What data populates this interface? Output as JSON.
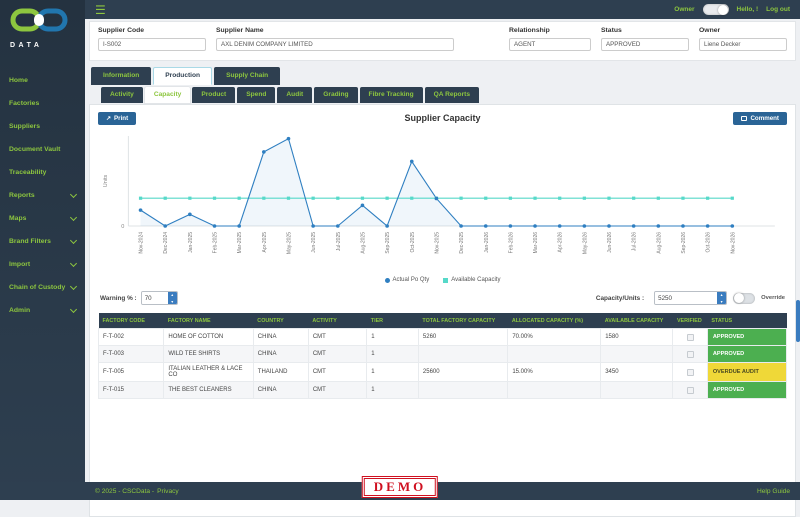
{
  "colors": {
    "dark": "#2e3f50",
    "accent_green": "#8dc63f",
    "button_blue": "#2a6496",
    "badge_green": "#4caf50",
    "badge_yellow": "#efd838",
    "actual_line": "#2f7fc1",
    "available_line": "#56d9c9",
    "demo_red": "#cf1020"
  },
  "logo": {
    "brand": "CSC",
    "sub": "DATA"
  },
  "topbar": {
    "owner_toggle_label": "Owner",
    "greeting": "Hello, !",
    "logout": "Log out"
  },
  "sidebar": {
    "items": [
      {
        "label": "Home",
        "expandable": false
      },
      {
        "label": "Factories",
        "expandable": false
      },
      {
        "label": "Suppliers",
        "expandable": false
      },
      {
        "label": "Document Vault",
        "expandable": false
      },
      {
        "label": "Traceability",
        "expandable": false
      },
      {
        "label": "Reports",
        "expandable": true
      },
      {
        "label": "Maps",
        "expandable": true
      },
      {
        "label": "Brand Filters",
        "expandable": true
      },
      {
        "label": "Import",
        "expandable": true
      },
      {
        "label": "Chain of Custody",
        "expandable": true
      },
      {
        "label": "Admin",
        "expandable": true
      }
    ]
  },
  "supplier_form": {
    "fields": [
      {
        "label": "Supplier Code",
        "value": "I-S002"
      },
      {
        "label": "Supplier Name",
        "value": "AXL DENIM COMPANY LIMITED"
      },
      {
        "label": "Relationship",
        "value": "AGENT"
      },
      {
        "label": "Status",
        "value": "APPROVED"
      },
      {
        "label": "Owner",
        "value": "Liene Decker"
      }
    ]
  },
  "tabs": {
    "main": [
      {
        "label": "Information",
        "active": false
      },
      {
        "label": "Production",
        "active": true
      },
      {
        "label": "Supply Chain",
        "active": false
      }
    ],
    "sub": [
      {
        "label": "Activity",
        "active": false
      },
      {
        "label": "Capacity",
        "active": true
      },
      {
        "label": "Product",
        "active": false
      },
      {
        "label": "Spend",
        "active": false
      },
      {
        "label": "Audit",
        "active": false
      },
      {
        "label": "Grading",
        "active": false
      },
      {
        "label": "Fibre Tracking",
        "active": false
      },
      {
        "label": "QA Reports",
        "active": false
      }
    ]
  },
  "chart_card": {
    "print_label": "Print",
    "comment_label": "Comment",
    "title": "Supplier Capacity"
  },
  "chart_data": {
    "type": "line",
    "title": "Supplier Capacity",
    "ylabel": "Units",
    "ylim": [
      0,
      17000
    ],
    "grid": false,
    "legend_position": "bottom",
    "x": [
      "Nov-2024",
      "Dec-2024",
      "Jan-2025",
      "Feb-2025",
      "Mar-2025",
      "Apr-2025",
      "May-2025",
      "Jun-2025",
      "Jul-2025",
      "Aug-2025",
      "Sep-2025",
      "Oct-2025",
      "Nov-2025",
      "Dec-2025",
      "Jan-2026",
      "Feb-2026",
      "Mar-2026",
      "Apr-2026",
      "May-2026",
      "Jun-2026",
      "Jul-2026",
      "Aug-2026",
      "Sep-2026",
      "Oct-2026",
      "Nov-2026"
    ],
    "series": [
      {
        "name": "Actual Po Qty",
        "color": "#2f7fc1",
        "marker": "circle",
        "values": [
          3000,
          0,
          2200,
          0,
          0,
          14000,
          16500,
          0,
          0,
          3900,
          0,
          12200,
          5200,
          0,
          0,
          0,
          0,
          0,
          0,
          0,
          0,
          0,
          0,
          0,
          0
        ]
      },
      {
        "name": "Available Capacity",
        "color": "#56d9c9",
        "marker": "square",
        "values": [
          5250,
          5250,
          5250,
          5250,
          5250,
          5250,
          5250,
          5250,
          5250,
          5250,
          5250,
          5250,
          5250,
          5250,
          5250,
          5250,
          5250,
          5250,
          5250,
          5250,
          5250,
          5250,
          5250,
          5250,
          5250
        ]
      }
    ]
  },
  "controls": {
    "warning_label": "Warning % :",
    "warning_value": "70",
    "capacity_label": "Capacity/Units :",
    "capacity_value": "5250",
    "override_label": "Override"
  },
  "table": {
    "headers": [
      "FACTORY CODE",
      "FACTORY NAME",
      "COUNTRY",
      "ACTIVITY",
      "TIER",
      "TOTAL FACTORY CAPACITY",
      "ALLOCATED CAPACITY (%)",
      "AVAILABLE CAPACITY",
      "VERIFIED",
      "STATUS"
    ],
    "rows": [
      {
        "code": "F-T-002",
        "name": "HOME OF COTTON",
        "country": "CHINA",
        "activity": "CMT",
        "tier": "1",
        "total": "5260",
        "allocated": "70.00%",
        "available": "1580",
        "verified": false,
        "status": "APPROVED",
        "status_type": "green"
      },
      {
        "code": "F-T-003",
        "name": "WILD TEE SHIRTS",
        "country": "CHINA",
        "activity": "CMT",
        "tier": "1",
        "total": "",
        "allocated": "",
        "available": "",
        "verified": false,
        "status": "APPROVED",
        "status_type": "green"
      },
      {
        "code": "F-T-005",
        "name": "ITALIAN LEATHER & LACE CO",
        "country": "THAILAND",
        "activity": "CMT",
        "tier": "1",
        "total": "25600",
        "allocated": "15.00%",
        "available": "3450",
        "verified": false,
        "status": "OVERDUE AUDIT",
        "status_type": "yellow"
      },
      {
        "code": "F-T-015",
        "name": "THE BEST CLEANERS",
        "country": "CHINA",
        "activity": "CMT",
        "tier": "1",
        "total": "",
        "allocated": "",
        "available": "",
        "verified": false,
        "status": "APPROVED",
        "status_type": "green"
      }
    ]
  },
  "footer": {
    "copyright": "© 2025 - CSCData -",
    "privacy": "Privacy",
    "demo": "DEMO",
    "help": "Help Guide"
  }
}
